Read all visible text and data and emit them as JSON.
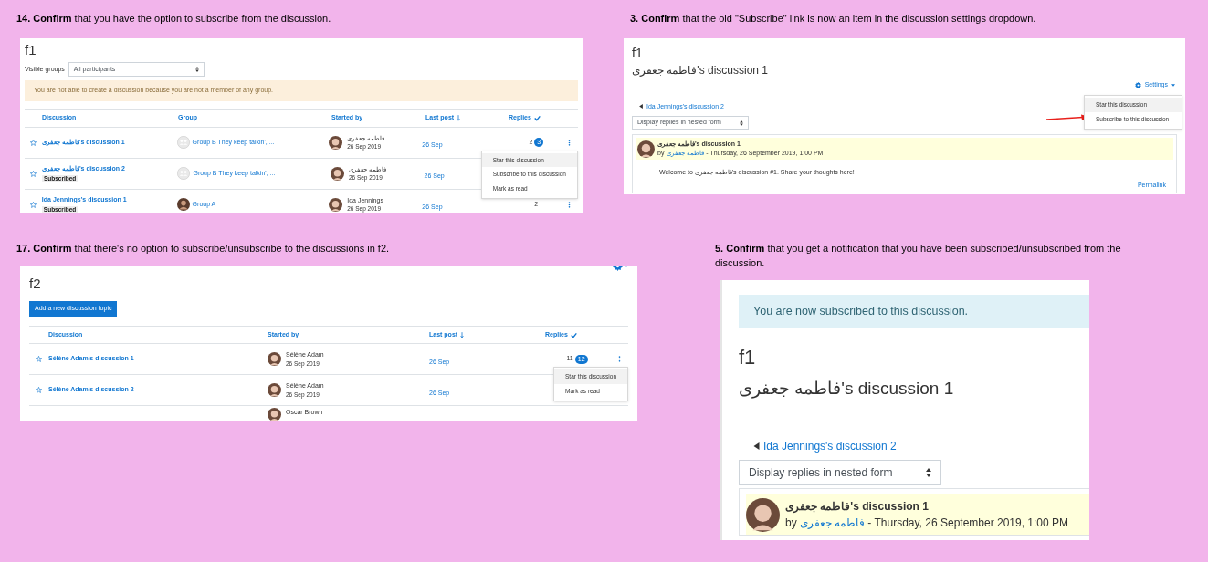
{
  "steps": [
    {
      "kind": "list",
      "instruction": "**14. Confirm** that you have the option to subscribe from the discussion.",
      "screen": {
        "title": "f1",
        "visible_groups": {
          "label": "Visible groups",
          "value": "All participants"
        },
        "alert": "You are not able to create a discussion because you are not a member of any group.",
        "columns": [
          {
            "label": "Discussion",
            "sorted": false,
            "checked": false
          },
          {
            "label": "Group",
            "sorted": false,
            "checked": false
          },
          {
            "label": "Started by",
            "sorted": false,
            "checked": false
          },
          {
            "label": "Last post",
            "sorted": true,
            "checked": false
          },
          {
            "label": "Replies",
            "sorted": false,
            "checked": true
          }
        ],
        "rows": [
          {
            "title": "فاطمه جعفری's discussion 1",
            "group": {
              "name": "Group B They keep talkin', ...",
              "has_photo": false
            },
            "author": "فاطمه جعفری",
            "date": "26 Sep 2019",
            "last_post": "26 Sep",
            "replies": "2",
            "unread": "3",
            "menu": [
              {
                "label": "Star this discussion",
                "highlighted": true
              },
              {
                "label": "Subscribe to this discussion",
                "highlighted": false
              },
              {
                "label": "Mark as read",
                "highlighted": false
              }
            ]
          },
          {
            "title": "فاطمه جعفری's discussion 2",
            "badge": "Subscribed",
            "group": {
              "name": "Group B They keep talkin', ...",
              "has_photo": false
            },
            "author": "فاطمه جعفری",
            "date": "26 Sep 2019",
            "last_post": "26 Sep"
          },
          {
            "title": "Ida Jennings's discussion 1",
            "badge": "Subscribed",
            "group": {
              "name": "Group A",
              "has_photo": true
            },
            "author": "Ida Jennings",
            "date": "26 Sep 2019",
            "last_post": "26 Sep",
            "replies": "2"
          }
        ]
      }
    },
    {
      "kind": "discussion",
      "instruction": "**3. Confirm** that the old \"Subscribe\" link is now an item in the discussion settings dropdown.",
      "screen": {
        "title": "f1",
        "heading": "فاطمه جعفری's discussion 1",
        "settings": {
          "label": "Settings",
          "menu": [
            {
              "label": "Star this discussion",
              "highlighted": true
            },
            {
              "label": "Subscribe to this discussion",
              "highlighted": false
            }
          ]
        },
        "previous": "Ida Jennings's discussion 2",
        "display_mode": "Display replies in nested form",
        "post": {
          "subject": "فاطمه جعفری's discussion 1",
          "by": "by",
          "author": "فاطمه جعفری",
          "date": " - Thursday, 26 September 2019, 1:00 PM",
          "body": "Welcome to فاطمه جعفری's discussion #1. Share your thoughts here!",
          "permalink": "Permalink"
        }
      }
    },
    {
      "kind": "list",
      "instruction": "**17. Confirm** that there's no option to subscribe/unsubscribe to the discussions in f2.",
      "screen": {
        "title": "f2",
        "add_button": "Add a new discussion topic",
        "columns": [
          {
            "label": "Discussion",
            "sorted": false,
            "checked": false
          },
          {
            "label": "Started by",
            "sorted": false,
            "checked": false
          },
          {
            "label": "Last post",
            "sorted": true,
            "checked": false
          },
          {
            "label": "Replies",
            "sorted": false,
            "checked": true
          }
        ],
        "rows": [
          {
            "title": "Sélène Adam's discussion 1",
            "author": "Sélène Adam",
            "date": "26 Sep 2019",
            "last_post": "26 Sep",
            "replies": "11",
            "unread": "12",
            "menu": [
              {
                "label": "Star this discussion",
                "highlighted": true
              },
              {
                "label": "Mark as read",
                "highlighted": false
              }
            ]
          },
          {
            "title": "Sélène Adam's discussion 2",
            "author": "Sélène Adam",
            "date": "26 Sep 2019",
            "last_post": "26 Sep"
          },
          {
            "author": "Oscar Brown"
          }
        ]
      }
    },
    {
      "kind": "discussion",
      "instruction": "**5. Confirm** that you get a notification that you have been subscribed/unsubscribed from the discussion.",
      "screen": {
        "notice": "You are now subscribed to this discussion.",
        "title": "f1",
        "heading": "فاطمه جعفری's discussion 1",
        "previous": "Ida Jennings's discussion 2",
        "display_mode": "Display replies in nested form",
        "post": {
          "subject": "فاطمه جعفری's discussion 1",
          "by": "by",
          "author": "فاطمه جعفری",
          "date": " - Thursday, 26 September 2019, 1:00 PM"
        }
      }
    }
  ]
}
